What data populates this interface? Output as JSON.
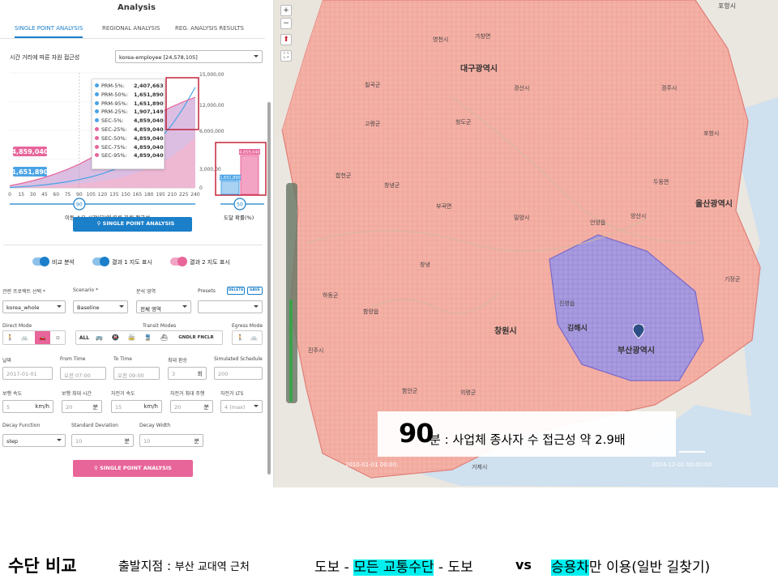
{
  "panel": {
    "title": "Analysis",
    "tabs": [
      "SINGLE POINT ANALYSIS",
      "REGIONAL ANALYSIS",
      "REG. ANALYSIS RESULTS"
    ],
    "chart_title": "시간 거리에 따른 자원 접근성",
    "dataset": "korea-employee [24,578,105]",
    "xaxis_label": "이동 소요 시간(분)에 따른 자원 접근성",
    "right_axis_label": "도달 확률(%)",
    "slider_value": "90",
    "right_slider_value": "50",
    "btn_single_top": "SINGLE POINT ANALYSIS",
    "toggles": [
      "비교 분석",
      "결과 1 지도 표시",
      "결과 2 지도 표시"
    ],
    "form": {
      "project_label": "관련 프로젝트 선택 *",
      "project_value": "korea_whole",
      "scenario_label": "Scenario *",
      "scenario_value": "Baseline",
      "area_label": "분석 영역",
      "area_value": "전체 영역",
      "presets_label": "Presets",
      "delete_label": "DELETE",
      "save_label": "SAVE",
      "direct_mode_label": "Direct Mode",
      "transit_modes_label": "Transit Modes",
      "egress_mode_label": "Egress Mode",
      "transit_all": "ALL",
      "transit_extra": "GNDLR FNCLR",
      "date_label": "날짜",
      "date_value": "2017-01-01",
      "from_label": "From Time",
      "from_value": "오전 07:00",
      "to_label": "To Time",
      "to_value": "오전 09:00",
      "transfers_label": "최대 환승",
      "transfers_value": "3",
      "transfers_unit": "회",
      "sim_label": "Simulated Schedule",
      "sim_value": "200",
      "walk_speed_label": "보행 속도",
      "walk_speed_value": "5",
      "walk_speed_unit": "km/h",
      "walk_time_label": "보행 최대 시간",
      "walk_time_value": "20",
      "walk_time_unit": "분",
      "bike_speed_label": "자전거 속도",
      "bike_speed_value": "15",
      "bike_speed_unit": "km/h",
      "bike_time_label": "자전거 최대 주행",
      "bike_time_value": "20",
      "bike_time_unit": "분",
      "lts_label": "자전거 LTS",
      "lts_value": "4 (max)",
      "decay_label": "Decay Function",
      "decay_value": "step",
      "sd_label": "Standard Deviation",
      "sd_value": "10",
      "sd_unit": "분",
      "width_label": "Decay Width",
      "width_value": "10",
      "width_unit": "분",
      "submit_label": "SINGLE POINT ANALYSIS"
    }
  },
  "colors": {
    "blue": "#4aa3e6",
    "pink": "#e8659a",
    "purple_fill": "#cfa8d8",
    "red_box": "#c0162e",
    "accent": "#1b7fc9",
    "map_pink": "#f2a9a0",
    "map_purple": "#9c8fd8"
  },
  "chart_data": {
    "type": "area",
    "x": [
      0,
      15,
      30,
      45,
      60,
      75,
      90,
      105,
      120,
      135,
      150,
      165,
      180,
      195,
      210,
      225,
      240
    ],
    "left_yticks": [
      "4,859,040",
      "1,651,890"
    ],
    "right_yticks": [
      "15,000,00",
      "12,000,00",
      "6,000,000",
      "3,000,00",
      "0"
    ],
    "tooltip": [
      {
        "name": "PRM-5%:",
        "value": "2,407,663",
        "color": "blue"
      },
      {
        "name": "PRM-50%:",
        "value": "1,651,890",
        "color": "blue"
      },
      {
        "name": "PRM-95%:",
        "value": "1,651,890",
        "color": "blue"
      },
      {
        "name": "PRM-25%:",
        "value": "1,907,149",
        "color": "blue"
      },
      {
        "name": "SEC-5%:",
        "value": "4,859,040",
        "color": "blue"
      },
      {
        "name": "SEC-25%:",
        "value": "4,859,040",
        "color": "pink"
      },
      {
        "name": "SEC-50%:",
        "value": "4,859,040",
        "color": "pink"
      },
      {
        "name": "SEC-75%:",
        "value": "4,859,040",
        "color": "pink"
      },
      {
        "name": "SEC-95%:",
        "value": "4,859,040",
        "color": "pink"
      }
    ],
    "series": [
      {
        "name": "PRM",
        "values": [
          60,
          150,
          260,
          420,
          620,
          860,
          1160,
          1520,
          1980,
          2550,
          3300,
          4200,
          5400,
          6900,
          8800,
          11200,
          14000
        ]
      },
      {
        "name": "SEC",
        "values": [
          300,
          620,
          1000,
          1450,
          1980,
          2600,
          3300,
          4150,
          5100,
          6200,
          7400,
          8600,
          9600,
          10500,
          11300,
          12000,
          12600
        ]
      }
    ],
    "bars": [
      {
        "name": "PRM",
        "value": "1,651,890",
        "amount": 1651890
      },
      {
        "name": "SEC",
        "value": "4,859,040",
        "amount": 4859040
      }
    ],
    "ylim": [
      0,
      16000
    ]
  },
  "map": {
    "cities": [
      {
        "name": "대구광역시",
        "big": true
      },
      {
        "name": "울산광역시",
        "big": true
      },
      {
        "name": "창원시",
        "big": true
      },
      {
        "name": "부산광역시",
        "big": true
      },
      {
        "name": "김해시",
        "big": false
      }
    ],
    "places": [
      "경산시",
      "영천시",
      "밀양시",
      "양산시",
      "청도군",
      "고령군",
      "함안군",
      "의령군",
      "거제시",
      "진주시",
      "칠곡군",
      "경주시",
      "합천군",
      "창녕군",
      "포항시",
      "창녕",
      "가창면",
      "언양읍",
      "하동군",
      "부곡면",
      "함양읍",
      "두동면",
      "진영읍",
      "기장군"
    ],
    "controls": [
      "+",
      "−",
      "⬆",
      "⛶"
    ],
    "timeline_start": "2010-01-01 00:00:",
    "timeline_end": "2024-12-01 00:00:00",
    "overlay_big": "90",
    "overlay_text": "분 : 사업체 종사자 수 접근성 약 2.9배",
    "top_place": "포항시"
  },
  "caption": {
    "heading": "수단 비교",
    "origin": "출발지점 : ",
    "origin_detail": "부산 교대역 근처",
    "walk": "도보 - ",
    "all_modes": "모든 교통수단",
    "walk_end": " - 도보",
    "vs": "vs",
    "car": "승용차",
    "car_rest": "만 이용(일반 길찾기)"
  }
}
